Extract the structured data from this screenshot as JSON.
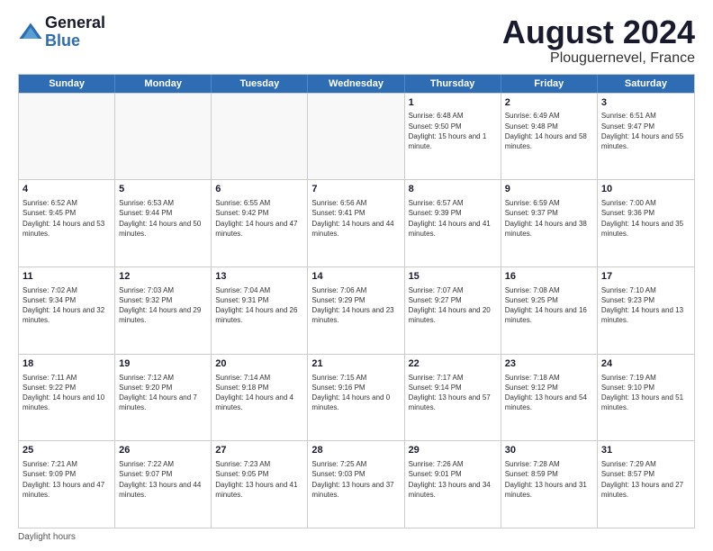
{
  "header": {
    "logo_line1": "General",
    "logo_line2": "Blue",
    "month_year": "August 2024",
    "location": "Plouguernevel, France"
  },
  "days_of_week": [
    "Sunday",
    "Monday",
    "Tuesday",
    "Wednesday",
    "Thursday",
    "Friday",
    "Saturday"
  ],
  "footer": "Daylight hours",
  "weeks": [
    [
      {
        "day": "",
        "sunrise": "",
        "sunset": "",
        "daylight": "",
        "empty": true
      },
      {
        "day": "",
        "sunrise": "",
        "sunset": "",
        "daylight": "",
        "empty": true
      },
      {
        "day": "",
        "sunrise": "",
        "sunset": "",
        "daylight": "",
        "empty": true
      },
      {
        "day": "",
        "sunrise": "",
        "sunset": "",
        "daylight": "",
        "empty": true
      },
      {
        "day": "1",
        "sunrise": "Sunrise: 6:48 AM",
        "sunset": "Sunset: 9:50 PM",
        "daylight": "Daylight: 15 hours and 1 minute.",
        "empty": false
      },
      {
        "day": "2",
        "sunrise": "Sunrise: 6:49 AM",
        "sunset": "Sunset: 9:48 PM",
        "daylight": "Daylight: 14 hours and 58 minutes.",
        "empty": false
      },
      {
        "day": "3",
        "sunrise": "Sunrise: 6:51 AM",
        "sunset": "Sunset: 9:47 PM",
        "daylight": "Daylight: 14 hours and 55 minutes.",
        "empty": false
      }
    ],
    [
      {
        "day": "4",
        "sunrise": "Sunrise: 6:52 AM",
        "sunset": "Sunset: 9:45 PM",
        "daylight": "Daylight: 14 hours and 53 minutes.",
        "empty": false
      },
      {
        "day": "5",
        "sunrise": "Sunrise: 6:53 AM",
        "sunset": "Sunset: 9:44 PM",
        "daylight": "Daylight: 14 hours and 50 minutes.",
        "empty": false
      },
      {
        "day": "6",
        "sunrise": "Sunrise: 6:55 AM",
        "sunset": "Sunset: 9:42 PM",
        "daylight": "Daylight: 14 hours and 47 minutes.",
        "empty": false
      },
      {
        "day": "7",
        "sunrise": "Sunrise: 6:56 AM",
        "sunset": "Sunset: 9:41 PM",
        "daylight": "Daylight: 14 hours and 44 minutes.",
        "empty": false
      },
      {
        "day": "8",
        "sunrise": "Sunrise: 6:57 AM",
        "sunset": "Sunset: 9:39 PM",
        "daylight": "Daylight: 14 hours and 41 minutes.",
        "empty": false
      },
      {
        "day": "9",
        "sunrise": "Sunrise: 6:59 AM",
        "sunset": "Sunset: 9:37 PM",
        "daylight": "Daylight: 14 hours and 38 minutes.",
        "empty": false
      },
      {
        "day": "10",
        "sunrise": "Sunrise: 7:00 AM",
        "sunset": "Sunset: 9:36 PM",
        "daylight": "Daylight: 14 hours and 35 minutes.",
        "empty": false
      }
    ],
    [
      {
        "day": "11",
        "sunrise": "Sunrise: 7:02 AM",
        "sunset": "Sunset: 9:34 PM",
        "daylight": "Daylight: 14 hours and 32 minutes.",
        "empty": false
      },
      {
        "day": "12",
        "sunrise": "Sunrise: 7:03 AM",
        "sunset": "Sunset: 9:32 PM",
        "daylight": "Daylight: 14 hours and 29 minutes.",
        "empty": false
      },
      {
        "day": "13",
        "sunrise": "Sunrise: 7:04 AM",
        "sunset": "Sunset: 9:31 PM",
        "daylight": "Daylight: 14 hours and 26 minutes.",
        "empty": false
      },
      {
        "day": "14",
        "sunrise": "Sunrise: 7:06 AM",
        "sunset": "Sunset: 9:29 PM",
        "daylight": "Daylight: 14 hours and 23 minutes.",
        "empty": false
      },
      {
        "day": "15",
        "sunrise": "Sunrise: 7:07 AM",
        "sunset": "Sunset: 9:27 PM",
        "daylight": "Daylight: 14 hours and 20 minutes.",
        "empty": false
      },
      {
        "day": "16",
        "sunrise": "Sunrise: 7:08 AM",
        "sunset": "Sunset: 9:25 PM",
        "daylight": "Daylight: 14 hours and 16 minutes.",
        "empty": false
      },
      {
        "day": "17",
        "sunrise": "Sunrise: 7:10 AM",
        "sunset": "Sunset: 9:23 PM",
        "daylight": "Daylight: 14 hours and 13 minutes.",
        "empty": false
      }
    ],
    [
      {
        "day": "18",
        "sunrise": "Sunrise: 7:11 AM",
        "sunset": "Sunset: 9:22 PM",
        "daylight": "Daylight: 14 hours and 10 minutes.",
        "empty": false
      },
      {
        "day": "19",
        "sunrise": "Sunrise: 7:12 AM",
        "sunset": "Sunset: 9:20 PM",
        "daylight": "Daylight: 14 hours and 7 minutes.",
        "empty": false
      },
      {
        "day": "20",
        "sunrise": "Sunrise: 7:14 AM",
        "sunset": "Sunset: 9:18 PM",
        "daylight": "Daylight: 14 hours and 4 minutes.",
        "empty": false
      },
      {
        "day": "21",
        "sunrise": "Sunrise: 7:15 AM",
        "sunset": "Sunset: 9:16 PM",
        "daylight": "Daylight: 14 hours and 0 minutes.",
        "empty": false
      },
      {
        "day": "22",
        "sunrise": "Sunrise: 7:17 AM",
        "sunset": "Sunset: 9:14 PM",
        "daylight": "Daylight: 13 hours and 57 minutes.",
        "empty": false
      },
      {
        "day": "23",
        "sunrise": "Sunrise: 7:18 AM",
        "sunset": "Sunset: 9:12 PM",
        "daylight": "Daylight: 13 hours and 54 minutes.",
        "empty": false
      },
      {
        "day": "24",
        "sunrise": "Sunrise: 7:19 AM",
        "sunset": "Sunset: 9:10 PM",
        "daylight": "Daylight: 13 hours and 51 minutes.",
        "empty": false
      }
    ],
    [
      {
        "day": "25",
        "sunrise": "Sunrise: 7:21 AM",
        "sunset": "Sunset: 9:09 PM",
        "daylight": "Daylight: 13 hours and 47 minutes.",
        "empty": false
      },
      {
        "day": "26",
        "sunrise": "Sunrise: 7:22 AM",
        "sunset": "Sunset: 9:07 PM",
        "daylight": "Daylight: 13 hours and 44 minutes.",
        "empty": false
      },
      {
        "day": "27",
        "sunrise": "Sunrise: 7:23 AM",
        "sunset": "Sunset: 9:05 PM",
        "daylight": "Daylight: 13 hours and 41 minutes.",
        "empty": false
      },
      {
        "day": "28",
        "sunrise": "Sunrise: 7:25 AM",
        "sunset": "Sunset: 9:03 PM",
        "daylight": "Daylight: 13 hours and 37 minutes.",
        "empty": false
      },
      {
        "day": "29",
        "sunrise": "Sunrise: 7:26 AM",
        "sunset": "Sunset: 9:01 PM",
        "daylight": "Daylight: 13 hours and 34 minutes.",
        "empty": false
      },
      {
        "day": "30",
        "sunrise": "Sunrise: 7:28 AM",
        "sunset": "Sunset: 8:59 PM",
        "daylight": "Daylight: 13 hours and 31 minutes.",
        "empty": false
      },
      {
        "day": "31",
        "sunrise": "Sunrise: 7:29 AM",
        "sunset": "Sunset: 8:57 PM",
        "daylight": "Daylight: 13 hours and 27 minutes.",
        "empty": false
      }
    ]
  ]
}
